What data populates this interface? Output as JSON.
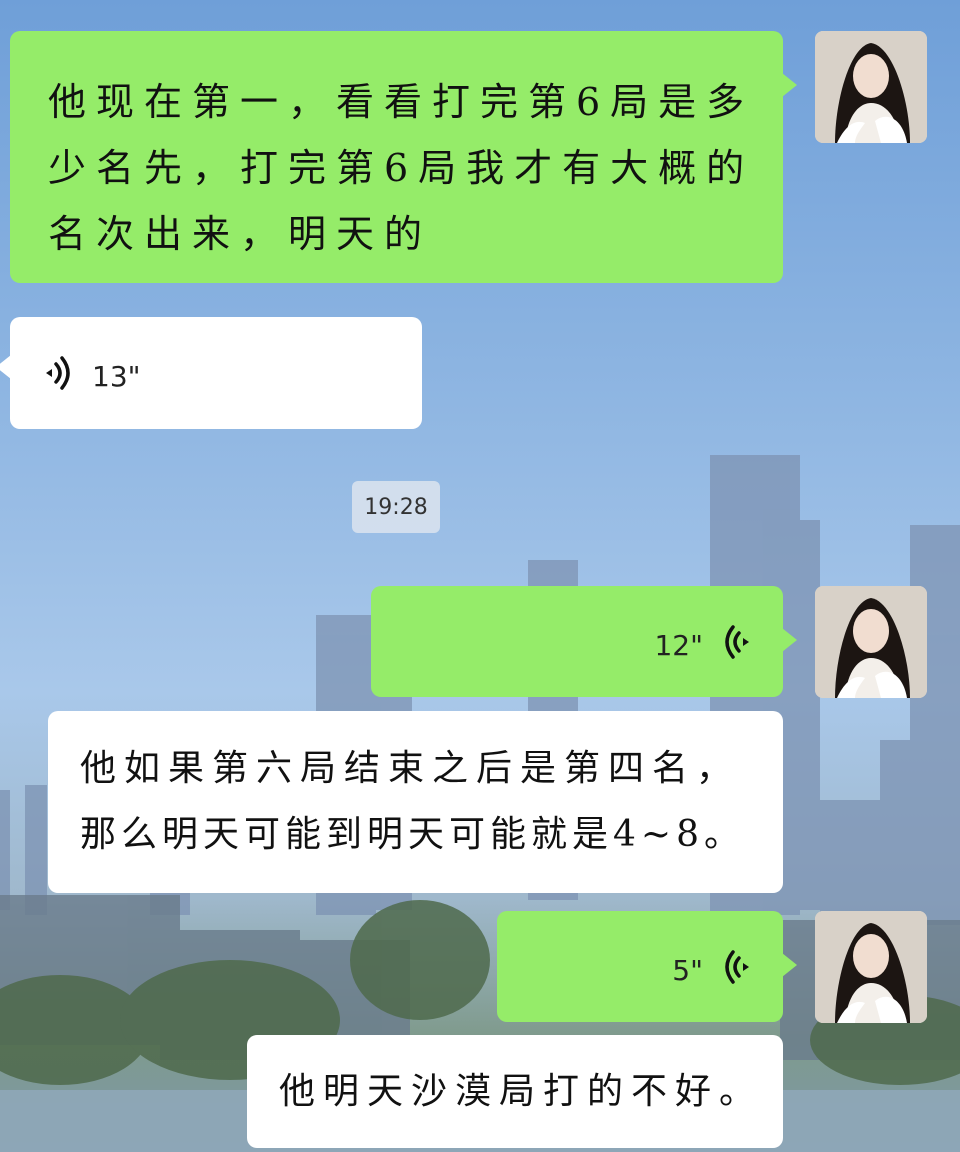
{
  "chat": {
    "timestamp": "19:28",
    "messages": [
      {
        "id": "m1",
        "side": "right",
        "type": "text",
        "lines": [
          "他现在第一，看看打完第6局是多",
          "少名先，打完第6局我才有大概的",
          "名次出来，明天的"
        ]
      },
      {
        "id": "m2",
        "side": "left",
        "type": "voice",
        "duration": "13\""
      },
      {
        "id": "m3",
        "side": "right",
        "type": "voice",
        "duration": "12\""
      },
      {
        "id": "m4",
        "side": "left",
        "type": "text",
        "lines": [
          "他如果第六局结束之后是第四名，",
          "那么明天可能到明天可能就是4~8。"
        ]
      },
      {
        "id": "m5",
        "side": "right",
        "type": "voice",
        "duration": "5\""
      },
      {
        "id": "m6",
        "side": "left",
        "type": "text",
        "lines": [
          "他明天沙漠局打的不好。"
        ]
      }
    ]
  },
  "colors": {
    "sent_bubble": "#95ec69",
    "received_bubble": "#ffffff"
  },
  "icons": {
    "voice": "voice-wave-icon",
    "avatar": "user-avatar"
  }
}
